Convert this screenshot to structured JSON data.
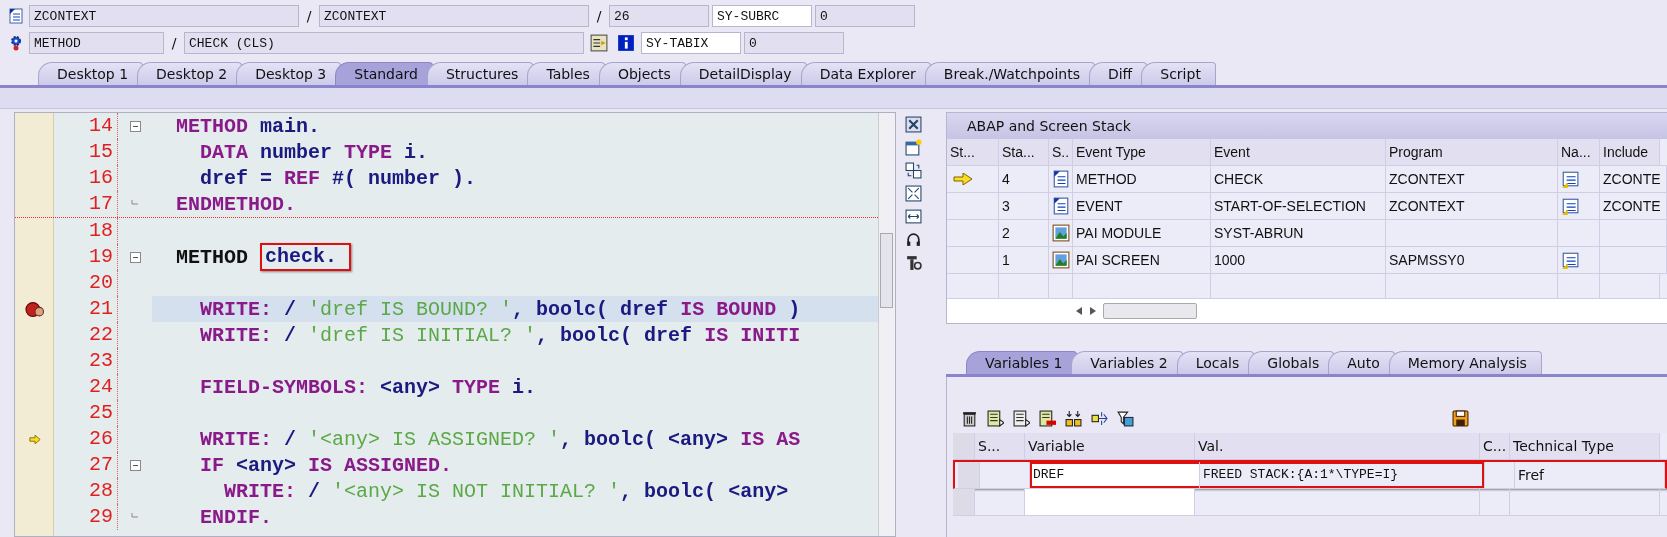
{
  "header": {
    "program": "ZCONTEXT",
    "sep1": "/",
    "include": "ZCONTEXT",
    "sep2": "/",
    "line": "26",
    "subrc_label": "SY-SUBRC",
    "subrc": "0",
    "event_type": "METHOD",
    "sep3": "/",
    "event": "CHECK (CLS)",
    "tabix_label": "SY-TABIX",
    "tabix": "0"
  },
  "tabs": [
    {
      "label": "Desktop 1",
      "selected": false
    },
    {
      "label": "Desktop 2",
      "selected": false
    },
    {
      "label": "Desktop 3",
      "selected": false
    },
    {
      "label": "Standard",
      "selected": true
    },
    {
      "label": "Structures",
      "selected": false
    },
    {
      "label": "Tables",
      "selected": false
    },
    {
      "label": "Objects",
      "selected": false
    },
    {
      "label": "DetailDisplay",
      "selected": false
    },
    {
      "label": "Data Explorer",
      "selected": false
    },
    {
      "label": "Break./Watchpoints",
      "selected": false
    },
    {
      "label": "Diff",
      "selected": false
    },
    {
      "label": "Script",
      "selected": false
    }
  ],
  "editor": {
    "lines": [
      {
        "number": "14",
        "fold_start": true,
        "tokens": [
          {
            "kind": "keyword",
            "text": "  METHOD"
          },
          {
            "kind": "name",
            "text": " main."
          }
        ]
      },
      {
        "number": "15",
        "tokens": [
          {
            "kind": "keyword",
            "text": "    DATA"
          },
          {
            "kind": "name",
            "text": " number"
          },
          {
            "kind": "keyword",
            "text": " TYPE"
          },
          {
            "kind": "name",
            "text": " i."
          }
        ]
      },
      {
        "number": "16",
        "tokens": [
          {
            "kind": "name",
            "text": "    dref ="
          },
          {
            "kind": "keyword",
            "text": " REF"
          },
          {
            "kind": "name",
            "text": " #( number )."
          }
        ]
      },
      {
        "number": "17",
        "fold_end": true,
        "block_end": true,
        "tokens": [
          {
            "kind": "keyword",
            "text": "  ENDMETHOD."
          }
        ]
      },
      {
        "number": "18"
      },
      {
        "number": "19",
        "fold_start": true,
        "tokens": [
          {
            "kind": "plain",
            "text": "  METHOD "
          },
          {
            "kind": "name",
            "text": "check.",
            "boxed": true
          }
        ]
      },
      {
        "number": "20"
      },
      {
        "number": "21",
        "breakpoint": true,
        "highlighted": true,
        "tokens": [
          {
            "kind": "keyword",
            "text": "    WRITE:"
          },
          {
            "kind": "name",
            "text": " /"
          },
          {
            "kind": "string",
            "text": " 'dref IS BOUND? '"
          },
          {
            "kind": "name",
            "text": ", boolc( dref"
          },
          {
            "kind": "keyword",
            "text": " IS BOUND"
          },
          {
            "kind": "name",
            "text": " )"
          }
        ]
      },
      {
        "number": "22",
        "tokens": [
          {
            "kind": "keyword",
            "text": "    WRITE:"
          },
          {
            "kind": "name",
            "text": " /"
          },
          {
            "kind": "string",
            "text": " 'dref IS INITIAL? '"
          },
          {
            "kind": "name",
            "text": ", boolc( dref"
          },
          {
            "kind": "keyword",
            "text": " IS INITI"
          }
        ]
      },
      {
        "number": "23"
      },
      {
        "number": "24",
        "tokens": [
          {
            "kind": "keyword",
            "text": "    FIELD-SYMBOLS:"
          },
          {
            "kind": "name",
            "text": " <any>"
          },
          {
            "kind": "keyword",
            "text": " TYPE"
          },
          {
            "kind": "name",
            "text": " i."
          }
        ]
      },
      {
        "number": "25"
      },
      {
        "number": "26",
        "current": true,
        "tokens": [
          {
            "kind": "keyword",
            "text": "    WRITE:"
          },
          {
            "kind": "name",
            "text": " /"
          },
          {
            "kind": "string",
            "text": " '<any> IS ASSIGNED? '"
          },
          {
            "kind": "name",
            "text": ", boolc( <any>"
          },
          {
            "kind": "keyword",
            "text": " IS AS"
          }
        ]
      },
      {
        "number": "27",
        "fold_start": true,
        "tokens": [
          {
            "kind": "keyword",
            "text": "    IF"
          },
          {
            "kind": "name",
            "text": " <any>"
          },
          {
            "kind": "keyword",
            "text": " IS ASSIGNED."
          }
        ]
      },
      {
        "number": "28",
        "tokens": [
          {
            "kind": "keyword",
            "text": "      WRITE:"
          },
          {
            "kind": "name",
            "text": " /"
          },
          {
            "kind": "string",
            "text": " '<any> IS NOT INITIAL? '"
          },
          {
            "kind": "name",
            "text": ", boolc( <any>"
          }
        ]
      },
      {
        "number": "29",
        "fold_end": true,
        "tokens": [
          {
            "kind": "keyword",
            "text": "    ENDIF."
          }
        ]
      }
    ]
  },
  "stack": {
    "title": "ABAP and Screen Stack",
    "columns": [
      "St...",
      "Sta...",
      "S..",
      "Event Type",
      "Event",
      "Program",
      "Na...",
      "Include"
    ],
    "rows": [
      {
        "current": true,
        "level": "4",
        "kind": "method",
        "event_type": "METHOD",
        "event": "CHECK",
        "program": "ZCONTEXT",
        "has_source": true,
        "include": "ZCONTE"
      },
      {
        "current": false,
        "level": "3",
        "kind": "method",
        "event_type": "EVENT",
        "event": "START-OF-SELECTION",
        "program": "ZCONTEXT",
        "has_source": true,
        "include": "ZCONTE"
      },
      {
        "current": false,
        "level": "2",
        "kind": "screen",
        "event_type": "PAI MODULE",
        "event": "SYST-ABRUN",
        "has_source": false
      },
      {
        "current": false,
        "level": "1",
        "kind": "screen",
        "event_type": "PAI SCREEN",
        "event": "1000",
        "program": "SAPMSSY0",
        "has_source": true
      }
    ]
  },
  "var_tabs": [
    {
      "label": "Variables 1",
      "selected": true
    },
    {
      "label": "Variables 2",
      "selected": false
    },
    {
      "label": "Locals",
      "selected": false
    },
    {
      "label": "Globals",
      "selected": false
    },
    {
      "label": "Auto",
      "selected": false
    },
    {
      "label": "Memory Analysis",
      "selected": false
    }
  ],
  "variables": {
    "columns": [
      "S...",
      "Variable",
      "Val.",
      "C...",
      "Technical Type"
    ],
    "rows": [
      {
        "variable": "DREF",
        "value": "FREED STACK:{A:1*\\TYPE=I}",
        "type": "Fref",
        "boxed": true
      }
    ]
  }
}
